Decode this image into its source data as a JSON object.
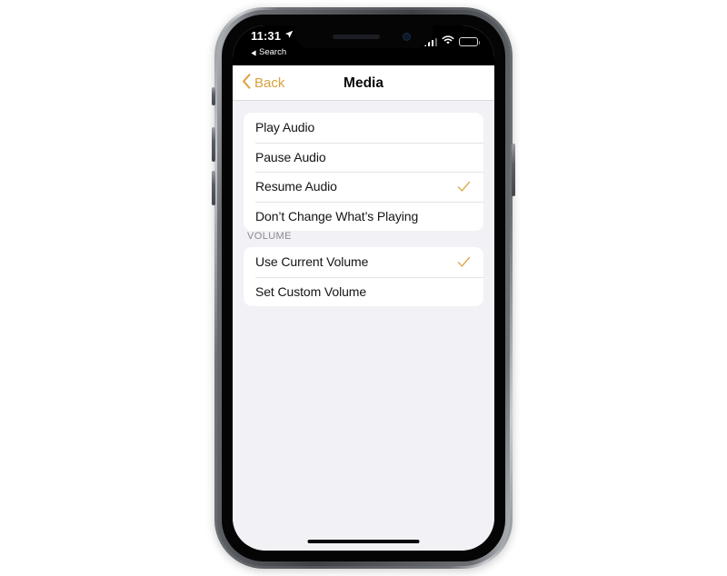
{
  "status_bar": {
    "time": "11:31",
    "location_icon": "location-arrow-icon",
    "back_to_app_label": "Search",
    "back_to_app_icon": "triangle-left-icon",
    "signal_icon": "cellular-signal-icon",
    "wifi_icon": "wifi-icon",
    "battery_icon": "battery-icon"
  },
  "nav_bar": {
    "back_label": "Back",
    "back_chevron_icon": "chevron-left-icon",
    "title": "Media"
  },
  "colors": {
    "accent": "#d9a13c",
    "screen_background": "#f1f1f6",
    "card_background": "#ffffff",
    "primary_text": "#141414",
    "section_header_text": "#8a8a8e"
  },
  "sections": [
    {
      "header": "",
      "rows": [
        {
          "label": "Play Audio",
          "checked": false
        },
        {
          "label": "Pause Audio",
          "checked": false
        },
        {
          "label": "Resume Audio",
          "checked": true
        },
        {
          "label": "Don’t Change What’s Playing",
          "checked": false
        }
      ]
    },
    {
      "header": "VOLUME",
      "rows": [
        {
          "label": "Use Current Volume",
          "checked": true
        },
        {
          "label": "Set Custom Volume",
          "checked": false
        }
      ]
    }
  ],
  "home_indicator": "home-indicator"
}
